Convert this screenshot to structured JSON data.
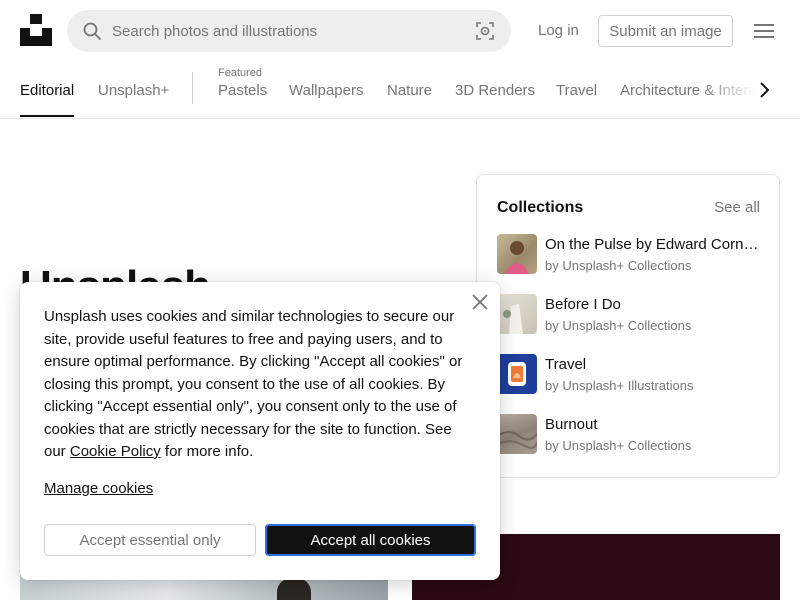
{
  "header": {
    "search_placeholder": "Search photos and illustrations",
    "login_label": "Log in",
    "submit_label": "Submit an image"
  },
  "topics": {
    "primary": [
      "Editorial",
      "Unsplash+"
    ],
    "featured_label": "Featured",
    "featured": [
      "Pastels",
      "Wallpapers",
      "Nature",
      "3D Renders",
      "Travel",
      "Architecture & Interiors"
    ]
  },
  "hero": {
    "title": "Unsplash"
  },
  "collections": {
    "title": "Collections",
    "see_all": "See all",
    "items": [
      {
        "name": "On the Pulse by Edward Cornish",
        "by": "by Unsplash+ Collections"
      },
      {
        "name": "Before I Do",
        "by": "by Unsplash+ Collections"
      },
      {
        "name": "Travel",
        "by": "by Unsplash+ Illustrations"
      },
      {
        "name": "Burnout",
        "by": "by Unsplash+ Collections"
      }
    ]
  },
  "cookie": {
    "text_before_link": "Unsplash uses cookies and similar technologies to secure our site, provide useful features to free and paying users, and to ensure optimal performance. By clicking \"Accept all cookies\" or closing this prompt, you consent to the use of all cookies. By clicking \"Accept essential only\", you consent only to the use of cookies that are strictly necessary for the site to function. See our ",
    "link_text": "Cookie Policy",
    "text_after_link": " for more info.",
    "manage_label": "Manage cookies",
    "essential_label": "Accept essential only",
    "accept_all_label": "Accept all cookies"
  },
  "colors": {
    "text": "#111111",
    "muted": "#767676",
    "accent_focus": "#2f6fdb",
    "search_bg": "#eeeeee"
  }
}
